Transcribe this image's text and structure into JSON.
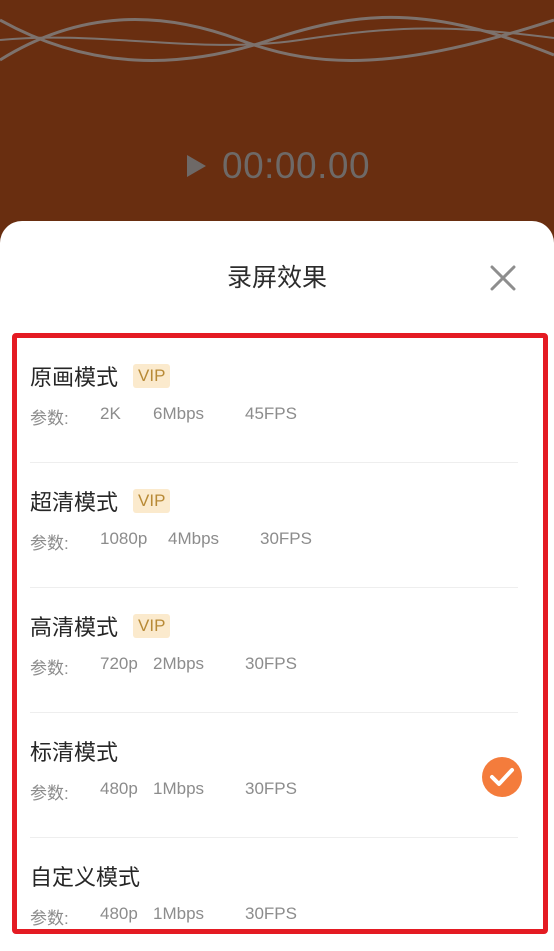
{
  "player": {
    "play_icon": "play-icon",
    "time": "00:00.00"
  },
  "sheet": {
    "title": "录屏效果",
    "close_icon": "close-icon",
    "accent_color": "#f47c3c",
    "highlight_border_color": "#e41b23",
    "options": [
      {
        "name": "原画模式",
        "vip": "VIP",
        "params_label": "参数:",
        "resolution": "2K",
        "bitrate": "6Mbps",
        "fps": "45FPS",
        "selected": false
      },
      {
        "name": "超清模式",
        "vip": "VIP",
        "params_label": "参数:",
        "resolution": "1080p",
        "bitrate": "4Mbps",
        "fps": "30FPS",
        "selected": false
      },
      {
        "name": "高清模式",
        "vip": "VIP",
        "params_label": "参数:",
        "resolution": "720p",
        "bitrate": "2Mbps",
        "fps": "30FPS",
        "selected": false
      },
      {
        "name": "标清模式",
        "vip": "",
        "params_label": "参数:",
        "resolution": "480p",
        "bitrate": "1Mbps",
        "fps": "30FPS",
        "selected": true
      },
      {
        "name": "自定义模式",
        "vip": "",
        "params_label": "参数:",
        "resolution": "480p",
        "bitrate": "1Mbps",
        "fps": "30FPS",
        "selected": false
      }
    ]
  }
}
